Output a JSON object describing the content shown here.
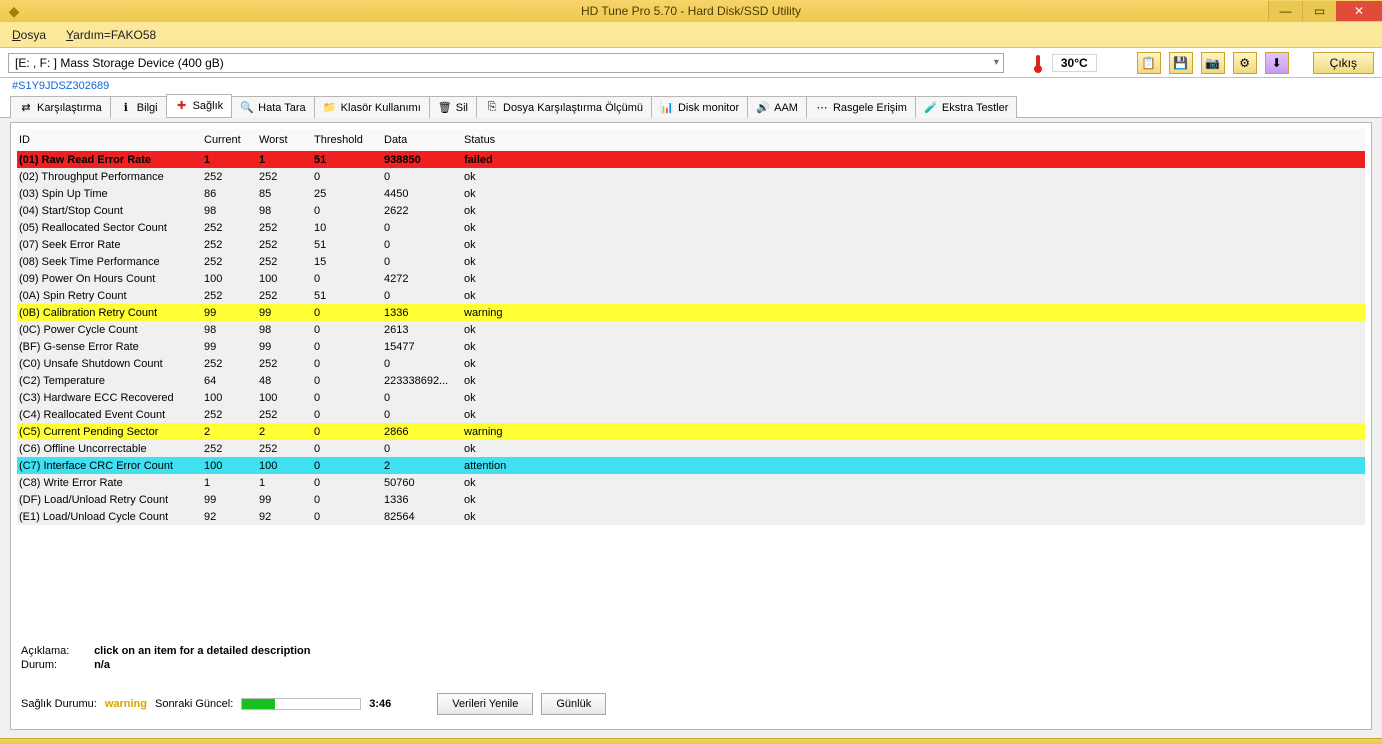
{
  "window": {
    "title": "HD Tune Pro 5.70 - Hard Disk/SSD Utility"
  },
  "menu": {
    "file": "Dosya",
    "help": "Yardım=FAKO58"
  },
  "device": {
    "selected": "[E: , F: ]   Mass Storage Device (400 gB)",
    "serial": "#S1Y9JDSZ302689",
    "temp": "30°C",
    "exit": "Çıkış"
  },
  "tabs": [
    {
      "icon": "⇄",
      "label": "Karşılaştırma"
    },
    {
      "icon": "ℹ",
      "label": "Bilgi"
    },
    {
      "icon": "✚",
      "label": "Sağlık",
      "active": true,
      "iconColor": "#d22"
    },
    {
      "icon": "🔍",
      "label": "Hata Tara"
    },
    {
      "icon": "📁",
      "label": "Klasör Kullanımı"
    },
    {
      "icon": "🗑",
      "label": "Sil"
    },
    {
      "icon": "⎘",
      "label": "Dosya Karşılaştırma Ölçümü"
    },
    {
      "icon": "📊",
      "label": "Disk monitor"
    },
    {
      "icon": "🔊",
      "label": "AAM"
    },
    {
      "icon": "⋯",
      "label": "Rasgele Erişim"
    },
    {
      "icon": "🧪",
      "label": "Ekstra Testler"
    }
  ],
  "grid": {
    "headers": [
      "ID",
      "Current",
      "Worst",
      "Threshold",
      "Data",
      "Status"
    ],
    "rows": [
      {
        "cells": [
          "(01) Raw Read Error Rate",
          "1",
          "1",
          "51",
          "938850",
          "failed"
        ],
        "cls": "row-failed"
      },
      {
        "cells": [
          "(02) Throughput Performance",
          "252",
          "252",
          "0",
          "0",
          "ok"
        ],
        "cls": "row-alt"
      },
      {
        "cells": [
          "(03) Spin Up Time",
          "86",
          "85",
          "25",
          "4450",
          "ok"
        ],
        "cls": "row-alt"
      },
      {
        "cells": [
          "(04) Start/Stop Count",
          "98",
          "98",
          "0",
          "2622",
          "ok"
        ],
        "cls": "row-alt"
      },
      {
        "cells": [
          "(05) Reallocated Sector Count",
          "252",
          "252",
          "10",
          "0",
          "ok"
        ],
        "cls": "row-alt"
      },
      {
        "cells": [
          "(07) Seek Error Rate",
          "252",
          "252",
          "51",
          "0",
          "ok"
        ],
        "cls": "row-alt"
      },
      {
        "cells": [
          "(08) Seek Time Performance",
          "252",
          "252",
          "15",
          "0",
          "ok"
        ],
        "cls": "row-alt"
      },
      {
        "cells": [
          "(09) Power On Hours Count",
          "100",
          "100",
          "0",
          "4272",
          "ok"
        ],
        "cls": "row-alt"
      },
      {
        "cells": [
          "(0A) Spin Retry Count",
          "252",
          "252",
          "51",
          "0",
          "ok"
        ],
        "cls": "row-alt"
      },
      {
        "cells": [
          "(0B) Calibration Retry Count",
          "99",
          "99",
          "0",
          "1336",
          "warning"
        ],
        "cls": "row-warning"
      },
      {
        "cells": [
          "(0C) Power Cycle Count",
          "98",
          "98",
          "0",
          "2613",
          "ok"
        ],
        "cls": "row-alt"
      },
      {
        "cells": [
          "(BF) G-sense Error Rate",
          "99",
          "99",
          "0",
          "15477",
          "ok"
        ],
        "cls": "row-alt"
      },
      {
        "cells": [
          "(C0) Unsafe Shutdown Count",
          "252",
          "252",
          "0",
          "0",
          "ok"
        ],
        "cls": "row-alt"
      },
      {
        "cells": [
          "(C2) Temperature",
          "64",
          "48",
          "0",
          "223338692...",
          "ok"
        ],
        "cls": "row-alt"
      },
      {
        "cells": [
          "(C3) Hardware ECC Recovered",
          "100",
          "100",
          "0",
          "0",
          "ok"
        ],
        "cls": "row-alt"
      },
      {
        "cells": [
          "(C4) Reallocated Event Count",
          "252",
          "252",
          "0",
          "0",
          "ok"
        ],
        "cls": "row-alt"
      },
      {
        "cells": [
          "(C5) Current Pending Sector",
          "2",
          "2",
          "0",
          "2866",
          "warning"
        ],
        "cls": "row-warning"
      },
      {
        "cells": [
          "(C6) Offline Uncorrectable",
          "252",
          "252",
          "0",
          "0",
          "ok"
        ],
        "cls": "row-alt"
      },
      {
        "cells": [
          "(C7) Interface CRC Error Count",
          "100",
          "100",
          "0",
          "2",
          "attention"
        ],
        "cls": "row-attention"
      },
      {
        "cells": [
          "(C8) Write Error Rate",
          "1",
          "1",
          "0",
          "50760",
          "ok"
        ],
        "cls": "row-alt"
      },
      {
        "cells": [
          "(DF) Load/Unload Retry Count",
          "99",
          "99",
          "0",
          "1336",
          "ok"
        ],
        "cls": "row-alt"
      },
      {
        "cells": [
          "(E1) Load/Unload Cycle Count",
          "92",
          "92",
          "0",
          "82564",
          "ok"
        ],
        "cls": "row-alt"
      }
    ]
  },
  "desc": {
    "label1": "Açıklama:",
    "value1": "click on an item for a detailed description",
    "label2": "Durum:",
    "value2": "n/a"
  },
  "bottom": {
    "healthLabel": "Sağlık Durumu:",
    "healthValue": "warning",
    "nextLabel": "Sonraki Güncel:",
    "countdown": "3:46",
    "refresh": "Verileri Yenile",
    "log": "Günlük"
  }
}
